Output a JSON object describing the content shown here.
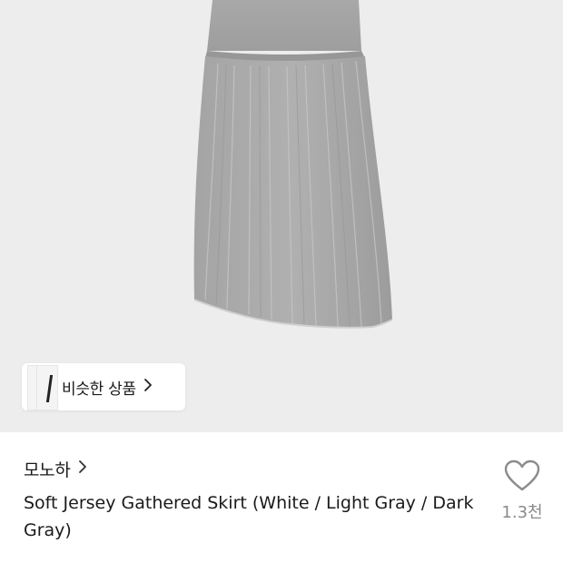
{
  "product": {
    "image": {
      "subject": "gray gathered skirt",
      "background": "#ededed",
      "garment_color": "#a9a9a9"
    },
    "similar_products": {
      "label": "비슷한 상품",
      "icon": "chevron-right-icon"
    },
    "brand": {
      "name": "모노하",
      "icon": "chevron-right-icon"
    },
    "title": "Soft Jersey Gathered Skirt (White / Light Gray / Dark Gray)",
    "like": {
      "icon": "heart-outline-icon",
      "count": "1.3천"
    }
  }
}
